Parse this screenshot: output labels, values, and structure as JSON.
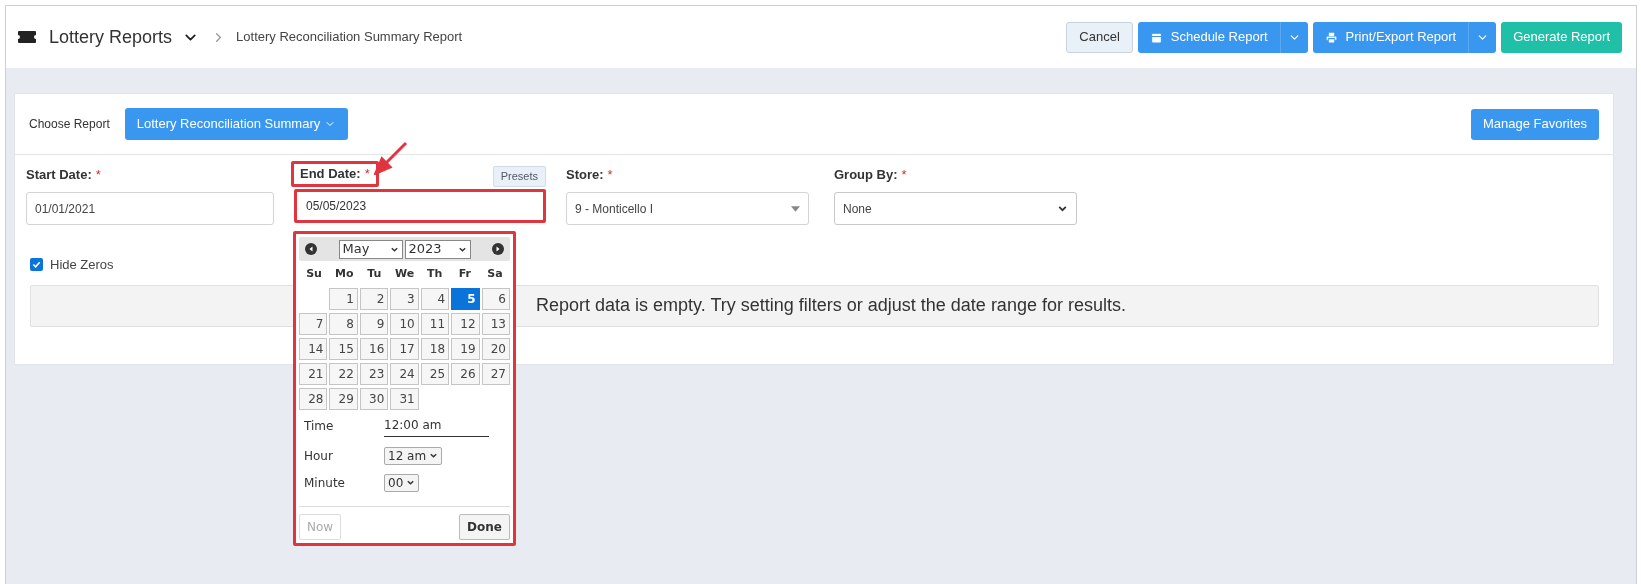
{
  "header": {
    "title": "Lottery Reports",
    "breadcrumb": "Lottery Reconciliation Summary Report",
    "buttons": [
      {
        "kind": "cancel",
        "label": "Cancel"
      },
      {
        "kind": "split",
        "label": "Schedule Report"
      },
      {
        "kind": "split",
        "label": "Print/Export Report"
      },
      {
        "kind": "primary",
        "label": "Generate Report"
      }
    ]
  },
  "report_picker": {
    "label": "Choose Report",
    "value": "Lottery Reconciliation Summary",
    "favorites_button": "Manage Favorites"
  },
  "filters": {
    "start_date": {
      "label": "Start Date:",
      "required": "*",
      "value": "01/01/2021"
    },
    "end_date": {
      "label": "End Date:",
      "required": "*",
      "value": "05/05/2023",
      "presets": "Presets"
    },
    "store": {
      "label": "Store:",
      "required": "*",
      "value": "9 - Monticello I"
    },
    "group_by": {
      "label": "Group By:",
      "required": "*",
      "value": "None"
    }
  },
  "hide_zeros": {
    "label": "Hide Zeros",
    "checked": true
  },
  "empty_message": "Report data is empty. Try setting filters or adjust the date range for results.",
  "datepicker": {
    "month": "May",
    "year": "2023",
    "weekdays": [
      "Su",
      "Mo",
      "Tu",
      "We",
      "Th",
      "Fr",
      "Sa"
    ],
    "weeks": [
      [
        {
          "label": "1",
          "selected": false
        },
        {
          "label": "2",
          "selected": false
        },
        {
          "label": "3",
          "selected": false
        },
        {
          "label": "4",
          "selected": false
        },
        {
          "label": "5",
          "selected": true
        },
        {
          "label": "6",
          "selected": false
        }
      ],
      [
        {
          "label": "7",
          "selected": false
        },
        {
          "label": "8",
          "selected": false
        },
        {
          "label": "9",
          "selected": false
        },
        {
          "label": "10",
          "selected": false
        },
        {
          "label": "11",
          "selected": false
        },
        {
          "label": "12",
          "selected": false
        },
        {
          "label": "13",
          "selected": false
        }
      ],
      [
        {
          "label": "14",
          "selected": false
        },
        {
          "label": "15",
          "selected": false
        },
        {
          "label": "16",
          "selected": false
        },
        {
          "label": "17",
          "selected": false
        },
        {
          "label": "18",
          "selected": false
        },
        {
          "label": "19",
          "selected": false
        },
        {
          "label": "20",
          "selected": false
        }
      ],
      [
        {
          "label": "21",
          "selected": false
        },
        {
          "label": "22",
          "selected": false
        },
        {
          "label": "23",
          "selected": false
        },
        {
          "label": "24",
          "selected": false
        },
        {
          "label": "25",
          "selected": false
        },
        {
          "label": "26",
          "selected": false
        },
        {
          "label": "27",
          "selected": false
        }
      ],
      [
        {
          "label": "28",
          "selected": false
        },
        {
          "label": "29",
          "selected": false
        },
        {
          "label": "30",
          "selected": false
        },
        {
          "label": "31",
          "selected": false
        }
      ]
    ],
    "time": {
      "label": "Time",
      "value": "12:00 am"
    },
    "hour": {
      "label": "Hour",
      "value": "12 am"
    },
    "minute": {
      "label": "Minute",
      "value": "00"
    },
    "now": {
      "label": "Now",
      "disabled": true
    },
    "done": {
      "label": "Done",
      "disabled": false
    }
  }
}
